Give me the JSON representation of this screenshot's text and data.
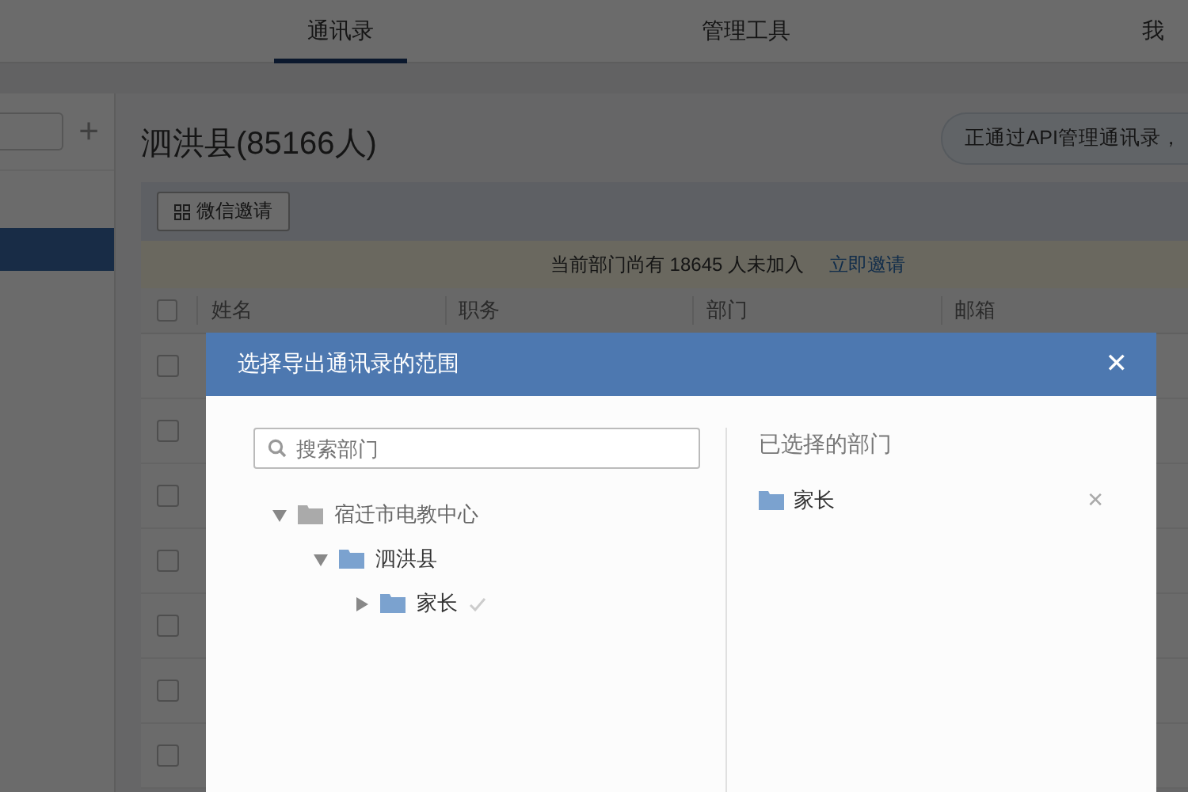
{
  "nav": {
    "tabs": [
      {
        "label": "通讯录",
        "selected": true
      },
      {
        "label": "管理工具",
        "selected": false
      },
      {
        "label": "我",
        "selected": false
      }
    ]
  },
  "sidebar": {
    "add_button": "+",
    "items": [
      {
        "selected": true
      }
    ]
  },
  "main": {
    "title": "泗洪县(85166人)",
    "api_notice": "正通过API管理通讯录，",
    "invite_button": "微信邀请",
    "banner": {
      "text": "当前部门尚有 18645 人未加入",
      "link": "立即邀请"
    },
    "table": {
      "header_checked": false,
      "columns": [
        "姓名",
        "职务",
        "部门",
        "邮箱"
      ],
      "rows": [
        {
          "checked": false
        },
        {
          "checked": false
        },
        {
          "checked": false
        },
        {
          "checked": false
        },
        {
          "checked": false
        },
        {
          "checked": false
        },
        {
          "checked": false
        }
      ]
    }
  },
  "dialog": {
    "title": "选择导出通讯录的范围",
    "close": "✕",
    "search": {
      "placeholder": "搜索部门"
    },
    "tree": [
      {
        "label": "宿迁市电教中心",
        "expanded": true,
        "kind": "root",
        "checked": false,
        "children": [
          {
            "label": "泗洪县",
            "expanded": true,
            "kind": "dept",
            "checked": false,
            "children": [
              {
                "label": "家长",
                "expanded": false,
                "kind": "dept",
                "checked": true
              }
            ]
          }
        ]
      }
    ],
    "selected_title": "已选择的部门",
    "selected": [
      {
        "label": "家长",
        "remove": "✕"
      }
    ]
  }
}
